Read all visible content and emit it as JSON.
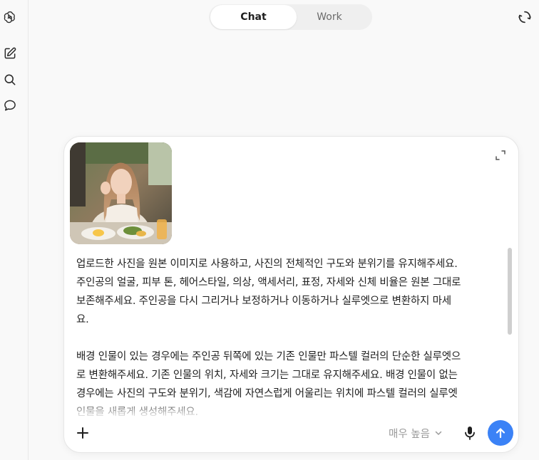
{
  "icons": {
    "logo": "openai-logo-icon",
    "new_chat": "new-chat-icon",
    "search": "search-icon",
    "chats": "chat-bubble-icon",
    "history": "history-icon",
    "expand": "expand-icon",
    "add": "plus-icon",
    "chevron": "chevron-down-icon",
    "mic": "mic-icon",
    "send": "arrow-up-icon"
  },
  "tabs": [
    {
      "label": "Chat",
      "active": true
    },
    {
      "label": "Work",
      "active": false
    }
  ],
  "composer": {
    "prompt": "업로드한 사진을 원본 이미지로 사용하고, 사진의 전체적인 구도와 분위기를 유지해주세요.\n주인공의 얼굴, 피부 톤, 헤어스타일, 의상, 액세서리, 표정, 자세와 신체 비율은 원본 그대로\n보존해주세요. 주인공을 다시 그리거나 보정하거나 이동하거나 실루엣으로 변환하지 마세\n요.\n\n배경 인물이 있는 경우에는 주인공 뒤쪽에 있는 기존 인물만 파스텔 컬러의 단순한 실루엣으\n로 변환해주세요. 기존 인물의 위치, 자세와 크기는 그대로 유지해주세요. 배경 인물이 없는\n경우에는 사진의 구도와 분위기, 색감에 자연스럽게 어울리는 위치에 파스텔 컬러의 실루엣\n인물을 새롭게 생성해주세요.",
    "model_label": "매우 높음"
  },
  "colors": {
    "accent": "#3b82f6",
    "background": "#f9f9f9"
  }
}
